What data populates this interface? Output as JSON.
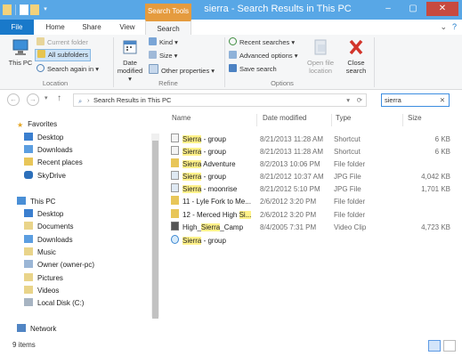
{
  "window": {
    "title": "sierra - Search Results in This PC",
    "context_tab": "Search Tools"
  },
  "tabs": {
    "file": "File",
    "home": "Home",
    "share": "Share",
    "view": "View",
    "search": "Search"
  },
  "ribbon": {
    "this_pc": "This PC",
    "current_folder": "Current folder",
    "all_subfolders": "All subfolders",
    "search_again": "Search again in",
    "location_group": "Location",
    "date_modified": "Date modified",
    "kind": "Kind",
    "size": "Size",
    "other_properties": "Other properties",
    "refine_group": "Refine",
    "recent_searches": "Recent searches",
    "advanced_options": "Advanced options",
    "save_search": "Save search",
    "open_file_location": "Open file location",
    "close_search": "Close search",
    "options_group": "Options"
  },
  "address": {
    "path": "Search Results in This PC",
    "search_value": "sierra"
  },
  "nav": {
    "favorites": "Favorites",
    "desktop": "Desktop",
    "downloads": "Downloads",
    "recent_places": "Recent places",
    "skydrive": "SkyDrive",
    "this_pc": "This PC",
    "pc_desktop": "Desktop",
    "documents": "Documents",
    "pc_downloads": "Downloads",
    "music": "Music",
    "owner": "Owner (owner-pc)",
    "pictures": "Pictures",
    "videos": "Videos",
    "local_disk": "Local Disk (C:)",
    "network": "Network"
  },
  "columns": {
    "name": "Name",
    "date": "Date modified",
    "type": "Type",
    "size": "Size"
  },
  "rows": [
    {
      "pre": "",
      "hl": "Sierra",
      "post": " - group",
      "date": "8/21/2013 11:28 AM",
      "type": "Shortcut",
      "size": "6 KB",
      "icon": "shortcut-icon"
    },
    {
      "pre": "",
      "hl": "Sierra",
      "post": " - group",
      "date": "8/21/2013 11:28 AM",
      "type": "Shortcut",
      "size": "6 KB",
      "icon": "shortcut-icon"
    },
    {
      "pre": "",
      "hl": "Sierra",
      "post": " Adventure",
      "date": "8/2/2013 10:06 PM",
      "type": "File folder",
      "size": "",
      "icon": "folder-icon"
    },
    {
      "pre": "",
      "hl": "Sierra",
      "post": " - group",
      "date": "8/21/2012 10:37 AM",
      "type": "JPG File",
      "size": "4,042 KB",
      "icon": "image-file-icon"
    },
    {
      "pre": "",
      "hl": "Sierra",
      "post": " - moonrise",
      "date": "8/21/2012 5:10 PM",
      "type": "JPG File",
      "size": "1,701 KB",
      "icon": "image-file-icon"
    },
    {
      "pre": "11 - Lyle Fork to Me...",
      "hl": "",
      "post": "",
      "date": "2/6/2012 3:20 PM",
      "type": "File folder",
      "size": "",
      "icon": "folder-icon"
    },
    {
      "pre": "12 - Merced High ",
      "hl": "Si...",
      "post": "",
      "date": "2/6/2012 3:20 PM",
      "type": "File folder",
      "size": "",
      "icon": "folder-icon"
    },
    {
      "pre": "High_",
      "hl": "Sierra",
      "post": "_Camp",
      "date": "8/4/2005 7:31 PM",
      "type": "Video Clip",
      "size": "4,723 KB",
      "icon": "video-file-icon"
    },
    {
      "pre": "",
      "hl": "Sierra",
      "post": " - group",
      "date": "",
      "type": "",
      "size": "",
      "icon": "web-shortcut-icon"
    }
  ],
  "status": {
    "count": "9 items"
  }
}
